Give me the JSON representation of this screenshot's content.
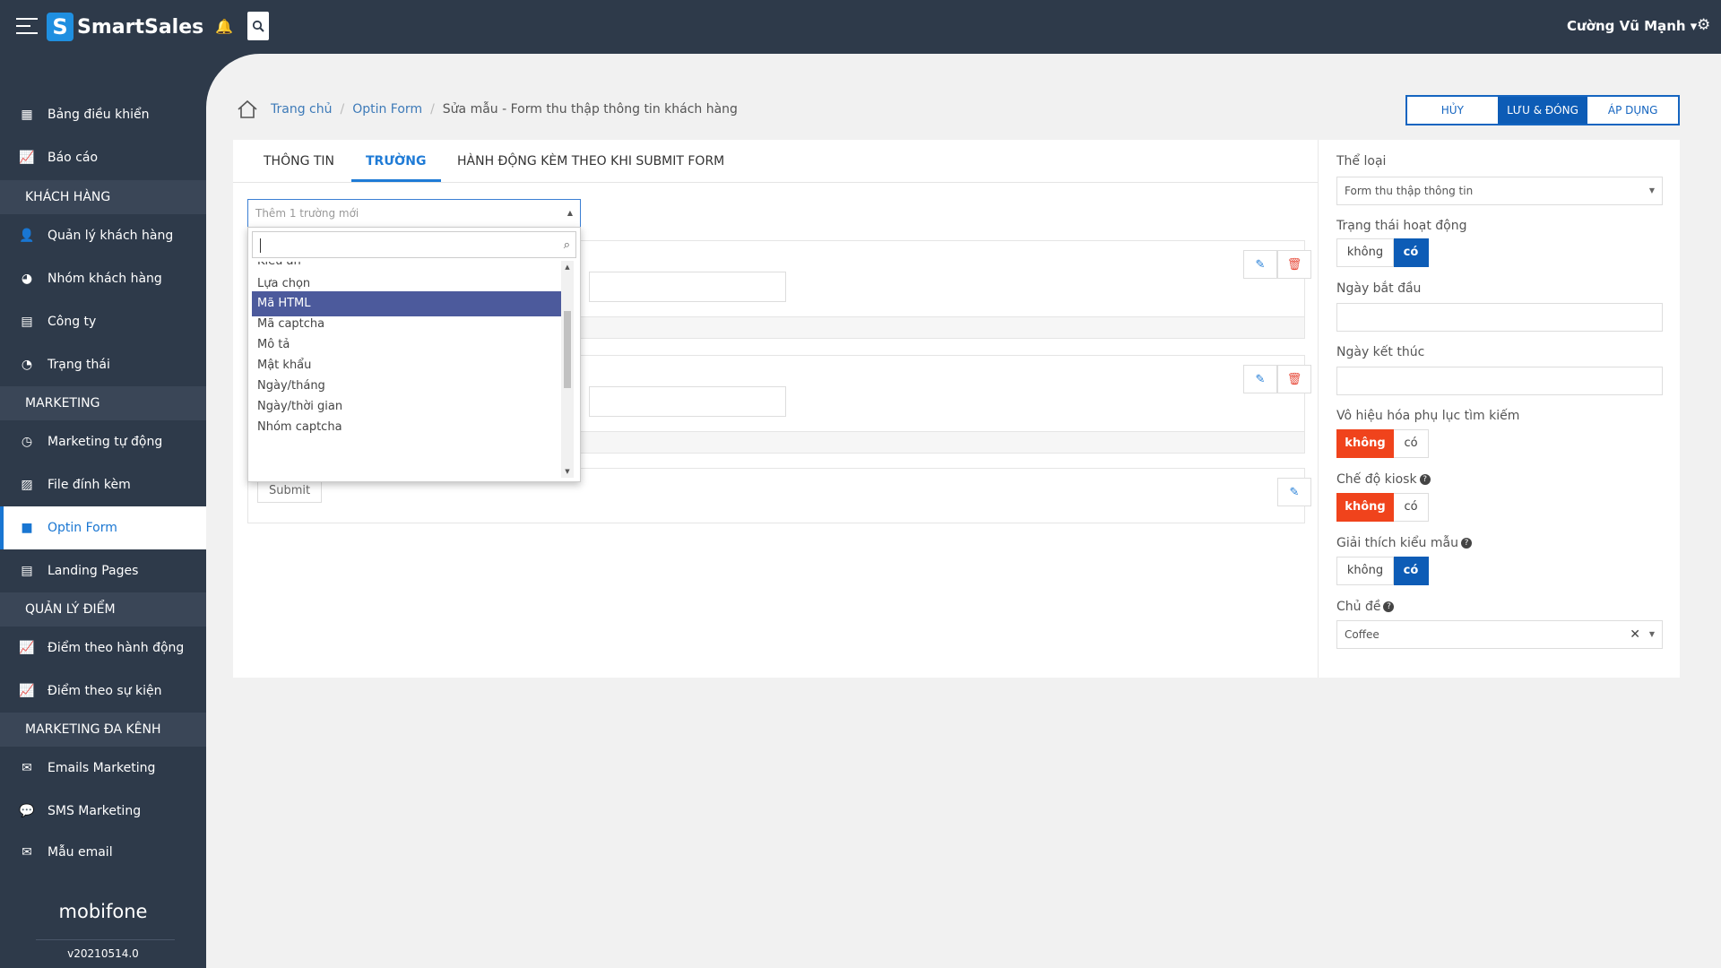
{
  "app": {
    "brand": "SmartSales",
    "logo_letter": "S",
    "user": "Cường Vũ Mạnh",
    "footer_brand": "mobifone",
    "version": "v20210514.0"
  },
  "icons": {
    "hamburger": "menu-icon",
    "bell": "bell-icon",
    "search": "search-icon",
    "settings": "gear-icon"
  },
  "sidebar": {
    "items": [
      {
        "label": "Bảng điều khiển",
        "icon": "grid-icon",
        "glyph": "▦"
      },
      {
        "label": "Báo cáo",
        "icon": "line-chart-icon",
        "glyph": "📈"
      },
      {
        "label": "Quản lý khách hàng",
        "icon": "user-icon",
        "glyph": "👤"
      },
      {
        "label": "Nhóm khách hàng",
        "icon": "pie-chart-icon",
        "glyph": "◕"
      },
      {
        "label": "Công ty",
        "icon": "building-icon",
        "glyph": "▤"
      },
      {
        "label": "Trạng thái",
        "icon": "dashboard-icon",
        "glyph": "◔"
      },
      {
        "label": "Marketing tự động",
        "icon": "clock-icon",
        "glyph": "◷"
      },
      {
        "label": "File đính kèm",
        "icon": "image-icon",
        "glyph": "▨"
      },
      {
        "label": "Optin Form",
        "icon": "square-icon",
        "glyph": "■"
      },
      {
        "label": "Landing Pages",
        "icon": "file-icon",
        "glyph": "▤"
      },
      {
        "label": "Điểm theo hành động",
        "icon": "line-chart-icon",
        "glyph": "📈"
      },
      {
        "label": "Điểm theo sự kiện",
        "icon": "line-chart-icon",
        "glyph": "📈"
      },
      {
        "label": "Emails Marketing",
        "icon": "envelope-icon",
        "glyph": "✉"
      },
      {
        "label": "SMS Marketing",
        "icon": "chat-icon",
        "glyph": "💬"
      },
      {
        "label": "Mẫu email",
        "icon": "envelope-icon",
        "glyph": "✉"
      }
    ],
    "sections": [
      "KHÁCH HÀNG",
      "MARKETING",
      "QUẢN LÝ ĐIỂM",
      "MARKETING ĐA KÊNH"
    ]
  },
  "breadcrumb": {
    "home": "Trang chủ",
    "parent": "Optin Form",
    "current": "Sửa mẫu - Form thu thập thông tin khách hàng"
  },
  "actions": {
    "cancel": "HỦY",
    "save_close": "LƯU & ĐÓNG",
    "apply": "ÁP DỤNG"
  },
  "tabs": [
    "THÔNG TIN",
    "TRƯỜNG",
    "HÀNH ĐỘNG KÈM THEO KHI SUBMIT FORM"
  ],
  "field_add": {
    "placeholder": "Thêm 1 trường mới",
    "options": [
      "Kiểu ẩn",
      "Lựa chọn",
      "Mã HTML",
      "Mã captcha",
      "Mô tả",
      "Mật khẩu",
      "Ngày/tháng",
      "Ngày/thời gian",
      "Nhóm captcha"
    ],
    "selected": "Mã HTML"
  },
  "submit_label": "Submit",
  "right_panel": {
    "category_label": "Thể loại",
    "category_value": "Form thu thập thông tin",
    "status_label": "Trạng thái hoạt động",
    "start_label": "Ngày bắt đầu",
    "end_label": "Ngày kết thúc",
    "disable_search_label": "Vô hiệu hóa phụ lục tìm kiếm",
    "kiosk_label": "Chế độ kiosk",
    "explain_label": "Giải thích kiểu mẫu",
    "theme_label": "Chủ đề",
    "theme_value": "Coffee",
    "no": "không",
    "yes": "có",
    "status_selected": "có",
    "disable_search_selected": "không",
    "kiosk_selected": "không",
    "explain_selected": "có"
  },
  "colors": {
    "sidebar_bg": "#2e3a4a",
    "accent_blue": "#0d5cb6",
    "accent_red": "#f0431c",
    "selected_option": "#4c5a9c"
  }
}
